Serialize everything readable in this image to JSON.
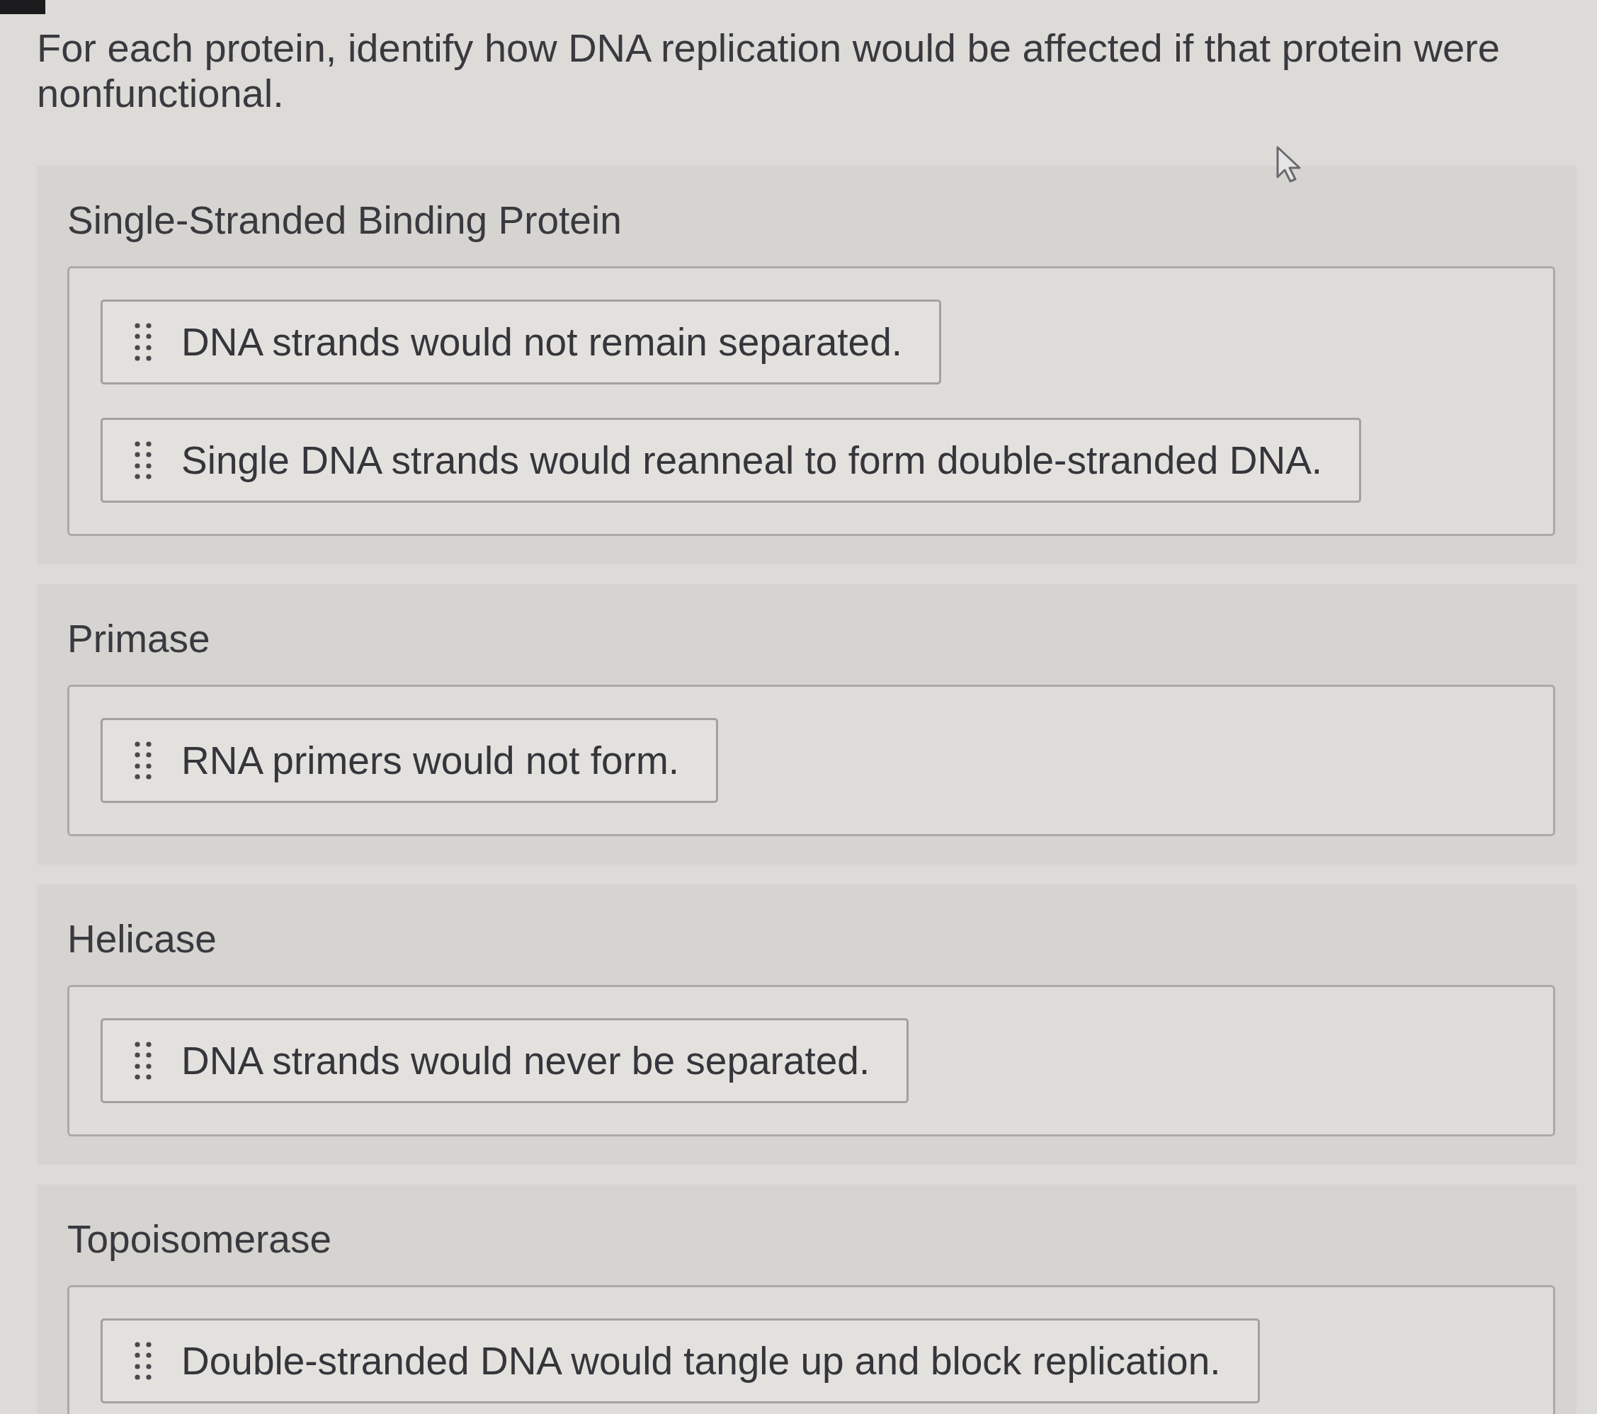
{
  "prompt": "For each protein, identify how DNA replication would be affected if that protein were nonfunctional.",
  "categories": [
    {
      "title": "Single-Stranded Binding Protein",
      "answers": [
        "DNA strands would not remain separated.",
        "Single DNA strands would reanneal to form double-stranded DNA."
      ]
    },
    {
      "title": "Primase",
      "answers": [
        "RNA primers would not form."
      ]
    },
    {
      "title": "Helicase",
      "answers": [
        "DNA strands would never be separated."
      ]
    },
    {
      "title": "Topoisomerase",
      "answers": [
        "Double-stranded DNA would tangle up and block replication."
      ]
    }
  ]
}
